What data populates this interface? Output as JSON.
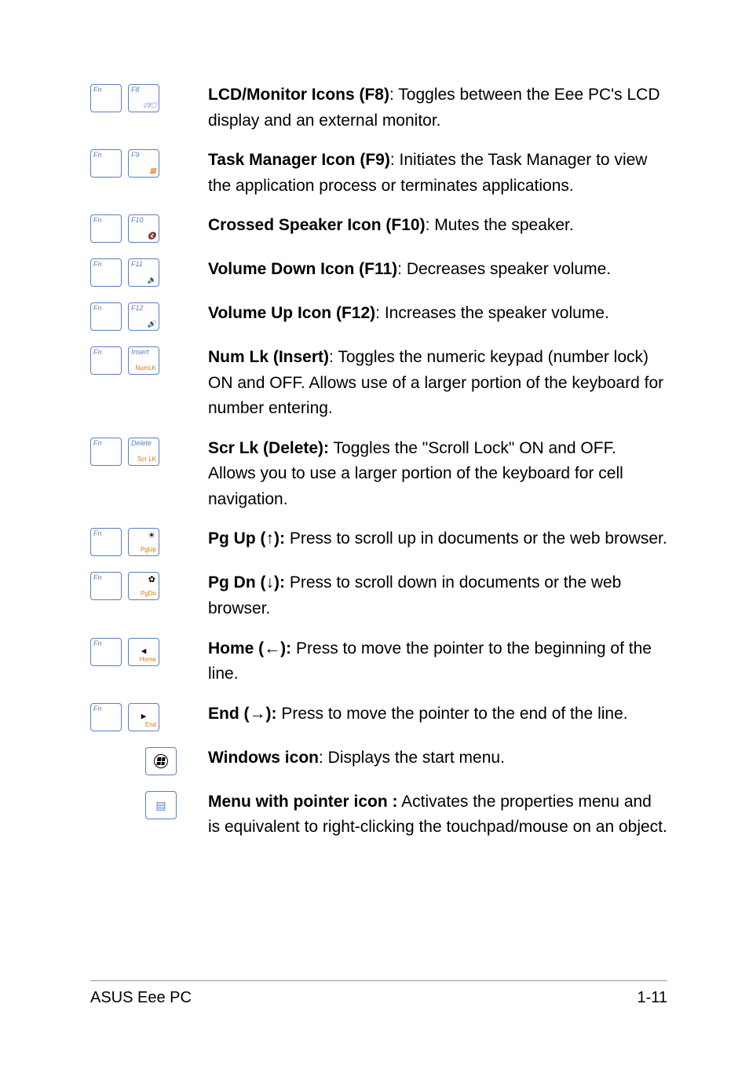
{
  "rows": [
    {
      "keys": [
        {
          "top": "Fn"
        },
        {
          "top": "F8",
          "icon": "⎚/▢",
          "iconColor": "#5a7fbf"
        }
      ],
      "label": "LCD/Monitor Icons (F8)",
      "sep": ": ",
      "text": "Toggles between the Eee PC's LCD display and an external monitor."
    },
    {
      "keys": [
        {
          "top": "Fn"
        },
        {
          "top": "F9",
          "icon": "▦",
          "iconColor": "#d97a00"
        }
      ],
      "label": "Task Manager Icon (F9)",
      "sep": ": ",
      "text": "Initiates the Task Manager to view the application process or terminates applications."
    },
    {
      "keys": [
        {
          "top": "Fn"
        },
        {
          "top": "F10",
          "icon": "🔇",
          "iconColor": "#d97a00"
        }
      ],
      "label": "Crossed Speaker Icon (F10)",
      "sep": ": ",
      "text": "Mutes the speaker."
    },
    {
      "keys": [
        {
          "top": "Fn"
        },
        {
          "top": "F11",
          "icon": "🔉",
          "iconColor": "#d97a00"
        }
      ],
      "label": "Volume Down Icon (F11)",
      "sep": ": ",
      "text": "Decreases speaker volume."
    },
    {
      "keys": [
        {
          "top": "Fn"
        },
        {
          "top": "F12",
          "icon": "🔊",
          "iconColor": "#d97a00"
        }
      ],
      "label": "Volume Up Icon (F12)",
      "sep": ": ",
      "text": "Increases the speaker volume."
    },
    {
      "keys": [
        {
          "top": "Fn"
        },
        {
          "top": "Insert",
          "sub": "NumLK",
          "subColor": "#d97a00"
        }
      ],
      "label": "Num Lk (Insert)",
      "sep": ": ",
      "text": "Toggles the numeric keypad (number lock) ON and OFF. Allows use of a larger portion of the keyboard for number entering."
    },
    {
      "keys": [
        {
          "top": "Fn"
        },
        {
          "top": "Delete",
          "sub": "Scr LK",
          "subColor": "#d97a00"
        }
      ],
      "label": "Scr Lk (Delete):",
      "sep": " ",
      "text": "Toggles the \"Scroll Lock\" ON and OFF. Allows you to use a larger portion of the keyboard for cell navigation."
    },
    {
      "keys": [
        {
          "top": "Fn"
        },
        {
          "centerSym": "☀",
          "sub": "PgUp",
          "subColor": "#d97a00"
        }
      ],
      "label": "Pg Up (↑):",
      "sep": " ",
      "text": "Press to scroll up in documents or the web browser."
    },
    {
      "keys": [
        {
          "top": "Fn"
        },
        {
          "centerSym": "✿",
          "sub": "PgDn",
          "subColor": "#d97a00"
        }
      ],
      "label": "Pg Dn (↓):",
      "sep": " ",
      "text": "Press to scroll down in documents or the web browser."
    },
    {
      "keys": [
        {
          "top": "Fn"
        },
        {
          "arrow": "◂",
          "sub": "Home",
          "subColor": "#d97a00"
        }
      ],
      "label": "Home (←):",
      "sep": " ",
      "text": "Press to move the pointer to the beginning of the line."
    },
    {
      "keys": [
        {
          "top": "Fn"
        },
        {
          "arrow": "▸",
          "sub": "End",
          "subColor": "#d97a00"
        }
      ],
      "label": "End (→):",
      "sep": " ",
      "text": "Press to move the pointer to the end of the line."
    },
    {
      "keys": [
        {
          "winlogo": true
        }
      ],
      "align": "right",
      "label": "Windows icon",
      "sep": ": ",
      "text": "Displays the start menu."
    },
    {
      "keys": [
        {
          "menuicon": true
        }
      ],
      "align": "right",
      "label": "Menu with pointer icon :",
      "sep": " ",
      "text": "Activates the properties menu and is equivalent to right-clicking the touchpad/mouse on an object."
    }
  ],
  "footer": {
    "left": "ASUS Eee PC",
    "right": "1-11"
  }
}
